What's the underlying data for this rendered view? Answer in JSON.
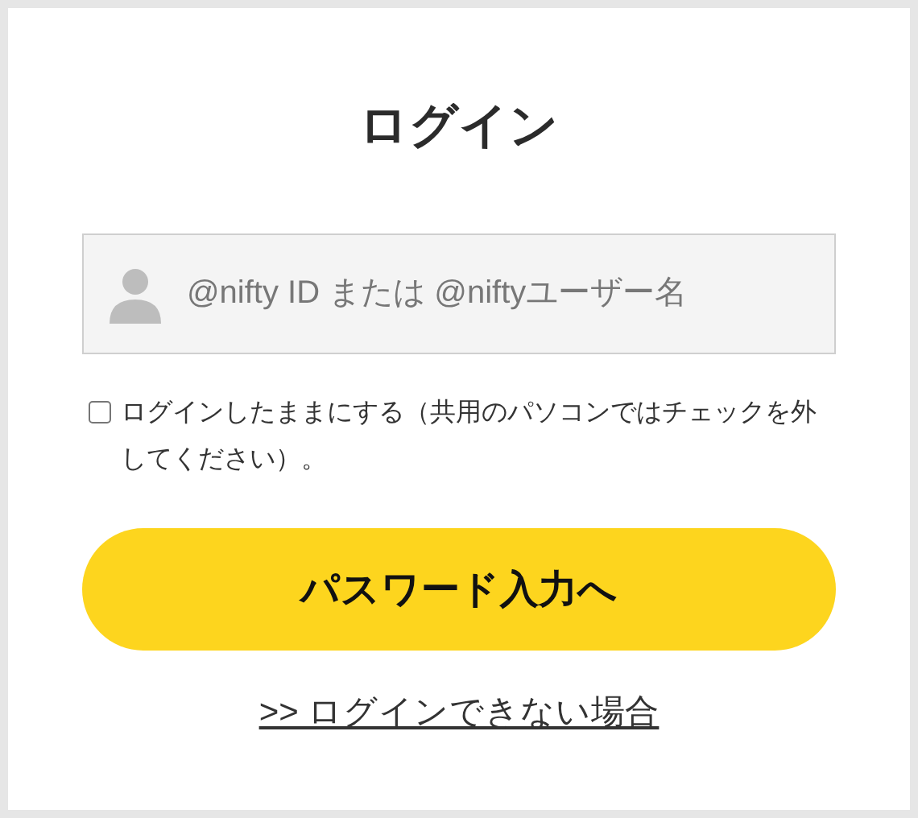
{
  "title": "ログイン",
  "id_field": {
    "placeholder": "@nifty ID または @niftyユーザー名"
  },
  "remember": {
    "label": "ログインしたままにする（共用のパソコンではチェックを外してください）。",
    "checked": false
  },
  "submit_button": "パスワード入力へ",
  "help_link": ">> ログインできない場合"
}
